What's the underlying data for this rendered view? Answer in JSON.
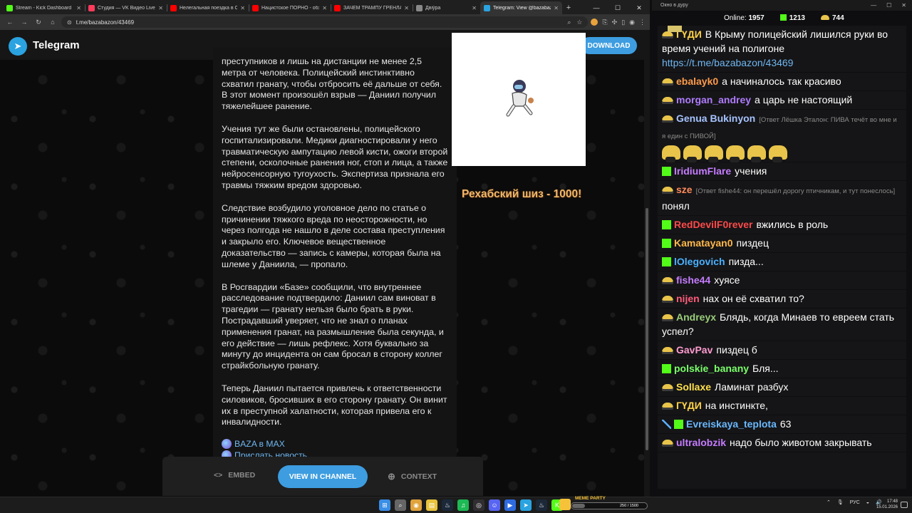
{
  "browser": {
    "tabs": [
      {
        "title": "Stream - Kick Dashboard",
        "color": "#53fc18"
      },
      {
        "title": "Студия — VK Видео Live",
        "color": "#ff3b5c"
      },
      {
        "title": "Нелегальная поездка в Сир...",
        "color": "#ff0000"
      },
      {
        "title": "Нацистское ПОРНО - обзор...",
        "color": "#ff0000"
      },
      {
        "title": "ЗАЧЕМ ТРАМПУ ГРЕНЛАНДИ...",
        "color": "#ff0000"
      },
      {
        "title": "Двіўра",
        "color": "#888888"
      },
      {
        "title": "Telegram: View @bazabazon",
        "color": "#2aa3e0"
      }
    ],
    "url": "t.me/bazabazon/43469",
    "window_controls": [
      "—",
      "☐",
      "✕"
    ]
  },
  "telegram": {
    "brand": "Telegram",
    "download_label": "DOWNLOAD",
    "paragraphs": [
      "преступников и лишь на дистанции не менее 2,5 метра от человека. Полицейский инстинктивно схватил гранату, чтобы отбросить её дальше от себя. В этот момент произошёл взрыв — Даниил получил тяжелейшее ранение.",
      "Учения тут же были остановлены, полицейского госпитализировали. Медики диагностировали у него травматическую ампутацию левой кисти, ожоги второй степени, осколочные ранения ног, стоп и лица, а также нейросенсорную тугоухость. Экспертиза признала его травмы тяжким вредом здоровью.",
      "Следствие возбудило уголовное дело по статье о причинении тяжкого вреда по неосторожности, но через полгода не нашло в деле состава преступления и закрыло его. Ключевое вещественное доказательство — запись с камеры, которая была на шлеме у Даниила, — пропало.",
      "В Росгвардии «Базе» сообщили, что внутреннее расследование подтвердило: Даниил сам виноват в трагедии — гранату нельзя было брать в руки. Пострадавший уверяет, что не знал о планах применения гранат, на размышление была секунда, и его действие — лишь рефлекс. Хотя буквально за минуту до инцидента он сам бросал в сторону коллег страйкбольную гранату.",
      "Теперь Даниил пытается привлечь к ответственности силовиков, бросивших в его сторону гранату. Он винит их в преступной халатности, которая привела его к инвалидности."
    ],
    "links": [
      "BAZA в MAX",
      "Прислать новость"
    ],
    "embed_label": "EMBED",
    "view_label": "VIEW IN CHANNEL",
    "context_label": "CONTEXT"
  },
  "overlay": {
    "text": "Рехабский шиз - 1000!"
  },
  "chat": {
    "window_title": "Окно в дуру",
    "online_label": "Online:",
    "online_value": "1957",
    "kick_count": "1213",
    "banana_count": "744",
    "messages": [
      {
        "badges": [
          "banana"
        ],
        "user": "ГҮДИ",
        "color": "#ffd24a",
        "text": "В Крыму полицейский лишился руки во время учений на полигоне",
        "link": "https://t.me/bazabazon/43469"
      },
      {
        "badges": [
          "banana"
        ],
        "user": "ebalayk0",
        "color": "#ff9b4a",
        "text": "а начиналось так красиво"
      },
      {
        "badges": [
          "banana"
        ],
        "user": "morgan_andrey",
        "color": "#b07cff",
        "text": "а царь не настоящий"
      },
      {
        "badges": [
          "banana"
        ],
        "user": "Genua Bukinyon",
        "color": "#a6c3ff",
        "reply": "[Ответ Лёшка Эталон: ПИВА течёт во мне и я един с ПИВОЙ]",
        "text": "",
        "emotes": 6
      },
      {
        "badges": [
          "kick"
        ],
        "user": "IridiumFlare",
        "color": "#c57cff",
        "text": "учения"
      },
      {
        "badges": [
          "banana"
        ],
        "user": "sze",
        "color": "#ff8a5c",
        "reply": "[Ответ fishe44: он перешёл дорогу птичникам, и тут понеслось]",
        "text": "понял"
      },
      {
        "badges": [
          "kick"
        ],
        "user": "RedDevilF0rever",
        "color": "#ff4a4a",
        "text": "вжились в роль"
      },
      {
        "badges": [
          "kick"
        ],
        "user": "Kamatayan0",
        "color": "#ffb84a",
        "text": "пиздец"
      },
      {
        "badges": [
          "kick"
        ],
        "user": "lOlegovich",
        "color": "#4ab0ff",
        "text": "пизда..."
      },
      {
        "badges": [
          "banana"
        ],
        "user": "fishe44",
        "color": "#c57cff",
        "text": "хуясе"
      },
      {
        "badges": [
          "banana"
        ],
        "user": "nijen",
        "color": "#ff5c7a",
        "text": "нах он её схватил то?"
      },
      {
        "badges": [
          "banana"
        ],
        "user": "Andreyx",
        "color": "#9acd7a",
        "text": "Блядь, когда Минаев то евреем стать успел?"
      },
      {
        "badges": [
          "banana"
        ],
        "user": "GavPav",
        "color": "#ff9bd0",
        "text": "пиздец б"
      },
      {
        "badges": [
          "kick"
        ],
        "user": "polskie_banany",
        "color": "#7aff6a",
        "text": "Бля..."
      },
      {
        "badges": [
          "banana"
        ],
        "user": "Sollaxe",
        "color": "#ffe04a",
        "text": "Ламинат разбух"
      },
      {
        "badges": [
          "banana"
        ],
        "user": "ГҮДИ",
        "color": "#ffd24a",
        "text": "на инстинкте,"
      },
      {
        "badges": [
          "sword",
          "kick"
        ],
        "user": "Evreiskaya_teplota",
        "color": "#6ab8ff",
        "text": "63"
      },
      {
        "badges": [
          "banana"
        ],
        "user": "ultralobzik",
        "color": "#c57cff",
        "text": "надо было животом закрывать"
      }
    ]
  },
  "taskbar": {
    "widget_label": "MEME PARTY",
    "widget_count": "250 / 1500",
    "widget_progress": 0.17,
    "lang": "РУС",
    "time": "17:48",
    "date": "15.01.2026",
    "icons": [
      "windows",
      "search",
      "chrome",
      "files",
      "steam",
      "spotify",
      "obs",
      "discord",
      "player",
      "telegram",
      "steam-2",
      "kick-studio"
    ]
  }
}
